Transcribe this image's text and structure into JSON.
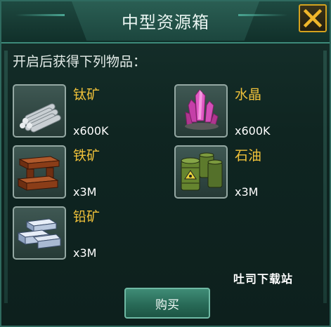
{
  "dialog": {
    "title": "中型资源箱",
    "subtitle": "开启后获得下列物品：",
    "close_icon": "close-icon",
    "items": [
      {
        "name": "钛矿",
        "qty": "x600K",
        "icon": "titanium-bars-icon"
      },
      {
        "name": "水晶",
        "qty": "x600K",
        "icon": "crystal-icon"
      },
      {
        "name": "铁矿",
        "qty": "x3M",
        "icon": "iron-ingots-icon"
      },
      {
        "name": "石油",
        "qty": "x3M",
        "icon": "oil-barrels-icon"
      },
      {
        "name": "铅矿",
        "qty": "x3M",
        "icon": "lead-ingots-icon"
      }
    ],
    "buy_label": "购买",
    "watermark": "吐司下载站",
    "colors": {
      "accent": "#f1c23a",
      "close": "#d4a21e",
      "frame": "#3d8a7a"
    }
  }
}
